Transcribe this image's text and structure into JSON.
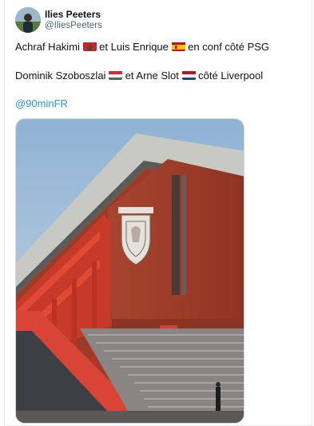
{
  "author": {
    "display_name": "Ilies Peeters",
    "handle": "@IliesPeeters",
    "avatar_icon": "user-avatar-icon"
  },
  "tweet": {
    "line1": {
      "part1": "Achraf Hakimi",
      "flag1": "morocco-flag-icon",
      "part2": "et Luis Enrique",
      "flag2": "spain-flag-icon",
      "part3": "en conf côté PSG"
    },
    "line2": {
      "part1": "Dominik Szoboszlai",
      "flag1": "hungary-flag-icon",
      "part2": "et Arne Slot",
      "flag2": "netherlands-flag-icon",
      "part3": "côté Liverpool"
    },
    "mention": "@90minFR"
  },
  "media": {
    "description_icon": "stadium-photo"
  },
  "colors": {
    "mention": "#1d9bf0",
    "text": "#0f1419",
    "secondary": "#536471"
  }
}
